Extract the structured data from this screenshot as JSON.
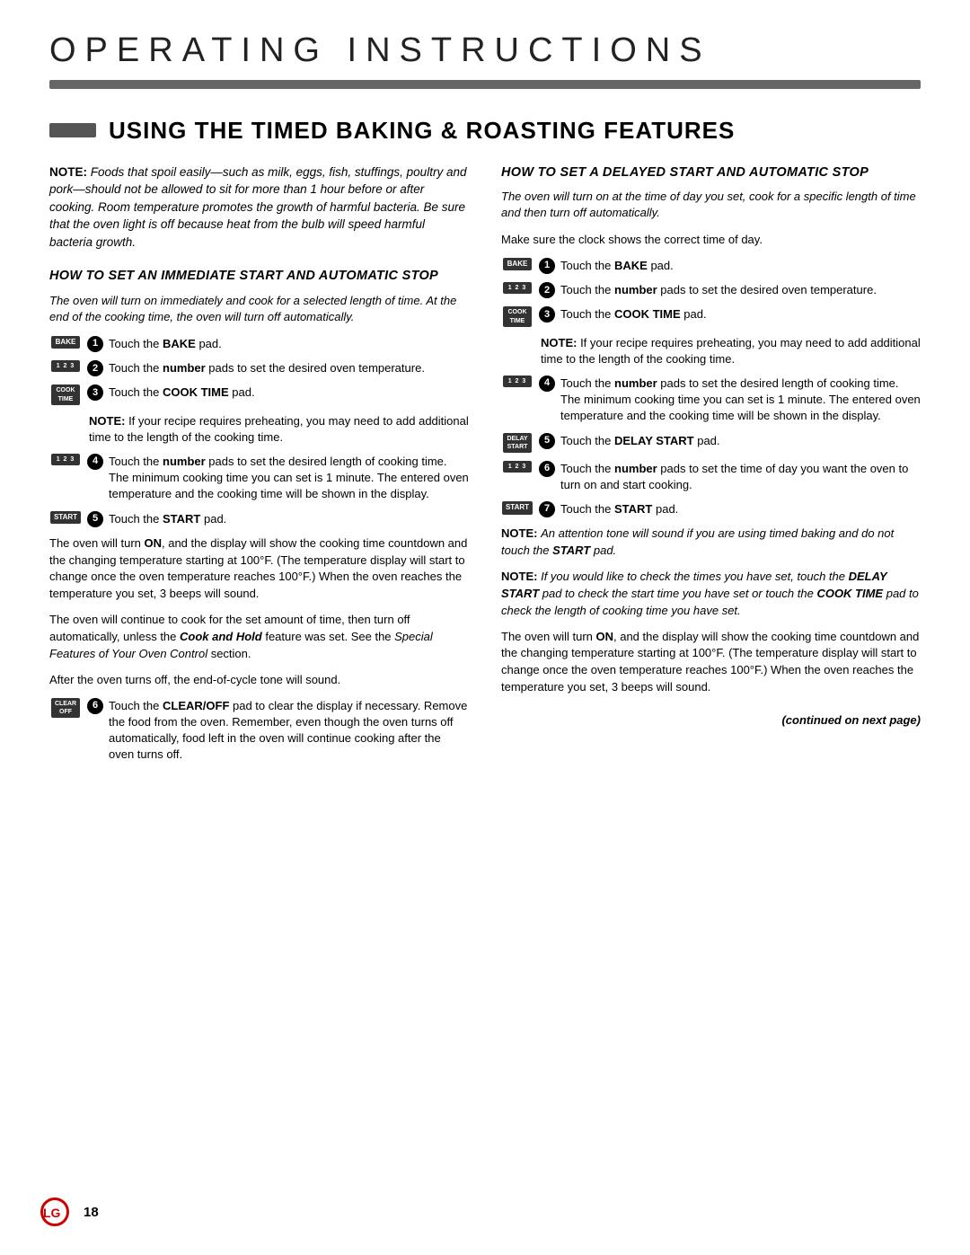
{
  "header": {
    "title": "Operating  Instructions",
    "bar_aria": "decorative bar"
  },
  "section": {
    "prefix_bar": "",
    "title": "Using the Timed Baking & Roasting Features"
  },
  "left_col": {
    "note_intro": {
      "label": "NOTE:",
      "text": "Foods that spoil easily—such as milk, eggs, fish, stuffings, poultry and pork—should not be allowed to sit for more than 1 hour before or after cooking. Room temperature promotes the growth of harmful bacteria. Be sure that the oven light is off because heat from the bulb will speed harmful bacteria growth."
    },
    "sub_heading1": "How to Set an Immediate Start and Automatic Stop",
    "sub_desc1": "The oven will turn on immediately and cook for a selected length of time. At the end of the cooking time, the oven will turn off automatically.",
    "steps_1": [
      {
        "id": "s1",
        "num": "1",
        "key_label": "BAKE",
        "key_type": "single",
        "text": "Touch the <b>BAKE</b> pad."
      },
      {
        "id": "s2",
        "num": "2",
        "key_label": "1  2  3",
        "key_type": "numbers",
        "text": "Touch the <b>number</b> pads to set the desired oven temperature."
      },
      {
        "id": "s3",
        "num": "3",
        "key_label": "COOK\nTIME",
        "key_type": "double",
        "text": "Touch the <b>COOK TIME</b> pad."
      }
    ],
    "note_preheating": "<b>NOTE:</b> If your recipe requires preheating, you may need to add additional time to the length of the cooking time.",
    "steps_2": [
      {
        "id": "s4",
        "num": "4",
        "key_label": "1  2  3",
        "key_type": "numbers",
        "text": "Touch the <b>number</b> pads to set the desired length of cooking time. The minimum cooking time you can set is 1 minute. The entered oven temperature and the cooking time will be shown in the display."
      },
      {
        "id": "s5",
        "num": "5",
        "key_label": "START",
        "key_type": "single",
        "text": "Touch the <b>START</b> pad."
      }
    ],
    "para1": "The oven will turn <b>ON</b>, and the display will show the cooking time countdown and the changing temperature starting at 100°F. (The temperature display will start to change once the oven temperature reaches 100°F.) When the oven reaches the temperature you set, 3 beeps will sound.",
    "para2": "The oven will continue to cook for the set amount of time, then turn off automatically, unless the <b><i>Cook and Hold</i></b> feature was set. See the <i>Special Features of Your Oven Control</i> section.",
    "para3": "After the oven turns off, the end-of-cycle tone will sound.",
    "step6": {
      "num": "6",
      "key_label1": "CLEAR",
      "key_label2": "OFF",
      "text": "Touch the <b>CLEAR/OFF</b> pad to clear the display if necessary. Remove the food from the oven. Remember, even though the oven turns off automatically, food left in the oven will continue cooking after the oven turns off."
    }
  },
  "right_col": {
    "sub_heading2": "How to Set a Delayed Start and Automatic Stop",
    "sub_desc2": "The oven will turn on at the time of day you set, cook for a specific length of time and then turn off automatically.",
    "make_sure": "Make sure the clock shows the correct time of day.",
    "steps_right": [
      {
        "id": "r1",
        "num": "1",
        "key_label": "BAKE",
        "key_type": "single",
        "text": "Touch the <b>BAKE</b> pad."
      },
      {
        "id": "r2",
        "num": "2",
        "key_label": "1  2  3",
        "key_type": "numbers",
        "text": "Touch the <b>number</b> pads to set the desired oven temperature."
      },
      {
        "id": "r3",
        "num": "3",
        "key_label": "COOK\nTIME",
        "key_type": "double",
        "text": "Touch the <b>COOK TIME</b> pad."
      }
    ],
    "note_preheating_r": "<b>NOTE:</b> If your recipe requires preheating, you may need to add additional time to the length of the cooking time.",
    "steps_right2": [
      {
        "id": "r4",
        "num": "4",
        "key_label": "1  2  3",
        "key_type": "numbers",
        "text": "Touch the <b>number</b> pads to set the desired length of cooking time. The minimum cooking time you can set is 1 minute. The entered oven temperature and the cooking time will be shown in the display."
      },
      {
        "id": "r5",
        "num": "5",
        "key_label": "DELAY\nSTART",
        "key_type": "double",
        "text": "Touch the <b>DELAY START</b> pad."
      },
      {
        "id": "r6",
        "num": "6",
        "key_label": "1  2  3",
        "key_type": "numbers",
        "text": "Touch the <b>number</b> pads to set the time of day you want the oven to turn on and start cooking."
      },
      {
        "id": "r7",
        "num": "7",
        "key_label": "START",
        "key_type": "single",
        "text": "Touch the <b>START</b> pad."
      }
    ],
    "note1": "<b>NOTE:</b> <i>An attention tone will sound if you are using timed baking and do not touch the <b>START</b> pad.</i>",
    "note2": "<b>NOTE:</b> <i>If you would like to check the times you have set, touch the <b>DELAY START</b> pad to check the start time you have set or touch the <b>COOK TIME</b> pad to check the length of cooking time you have set.</i>",
    "para_right1": "The oven will turn <b>ON</b>, and the display will show the cooking time countdown and the changing temperature starting at 100°F. (The temperature display will start to change once the oven temperature reaches 100°F.) When the oven reaches the temperature you set, 3 beeps will sound.",
    "continued": "(continued on next page)"
  },
  "footer": {
    "logo_text": "LG",
    "page_number": "18"
  }
}
